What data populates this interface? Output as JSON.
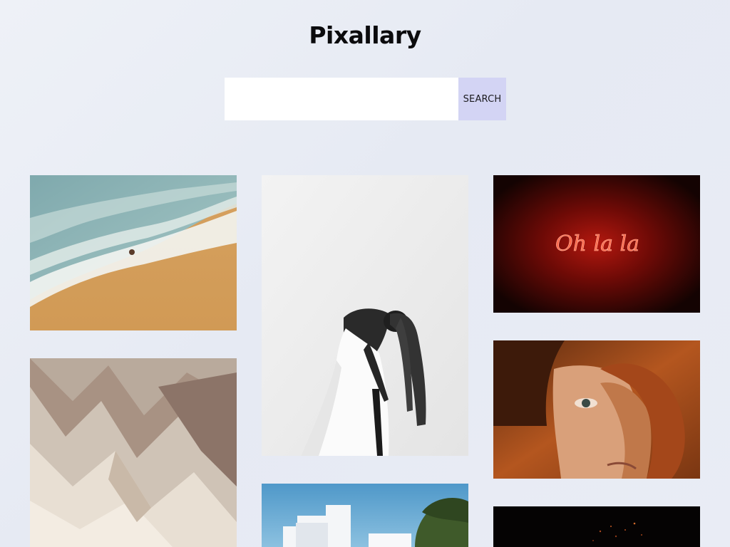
{
  "header": {
    "title": "Pixallary"
  },
  "search": {
    "placeholder": "",
    "value": "",
    "button_label": "SEARCH"
  },
  "gallery": {
    "photos": [
      {
        "subject": "aerial-beach-waves"
      },
      {
        "subject": "woman-braids-white-dress"
      },
      {
        "subject": "neon-sign",
        "sign_text": "Oh la la"
      },
      {
        "subject": "eroded-badlands"
      },
      {
        "subject": "redhead-curly-hair-portrait"
      },
      {
        "subject": "white-building-blue-sky"
      },
      {
        "subject": "dark-night-lights"
      }
    ]
  },
  "colors": {
    "background": "#e9ecf4",
    "search_button": "#d3d4f4",
    "title": "#0b0b0d"
  }
}
